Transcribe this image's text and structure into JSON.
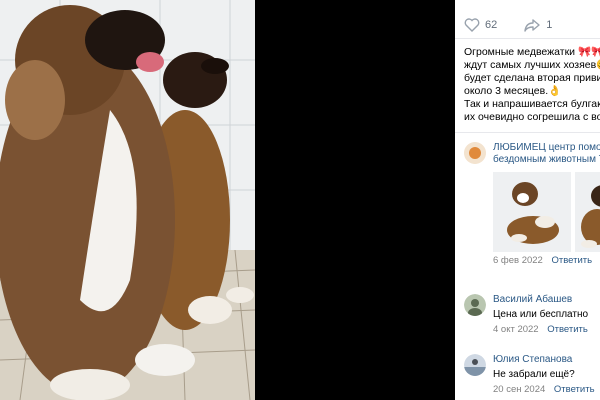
{
  "stats": {
    "likes": "62",
    "shares": "1"
  },
  "post": {
    "lines": [
      "Огромные медвежатки 🎀🎀Э",
      "ждут самых лучших хозяев😋",
      "будет сделана вторая прививка",
      "около 3 месяцев.👌",
      "Так и напрашивается булгаково",
      "их очевидно согрешила с водол"
    ]
  },
  "comments": [
    {
      "author_line1": "ЛЮБИМЕЦ центр помощи",
      "author_line2": "бездомным животным Ту",
      "date": "6 фев 2022",
      "reply": "Ответить"
    },
    {
      "author": "Василий Абашев",
      "text": "Цена или бесплатно",
      "date": "4 окт 2022",
      "reply": "Ответить"
    },
    {
      "author": "Юлия Степанова",
      "text": "Не забрали ещё?",
      "date": "20 сен 2024",
      "reply": "Ответить"
    }
  ]
}
